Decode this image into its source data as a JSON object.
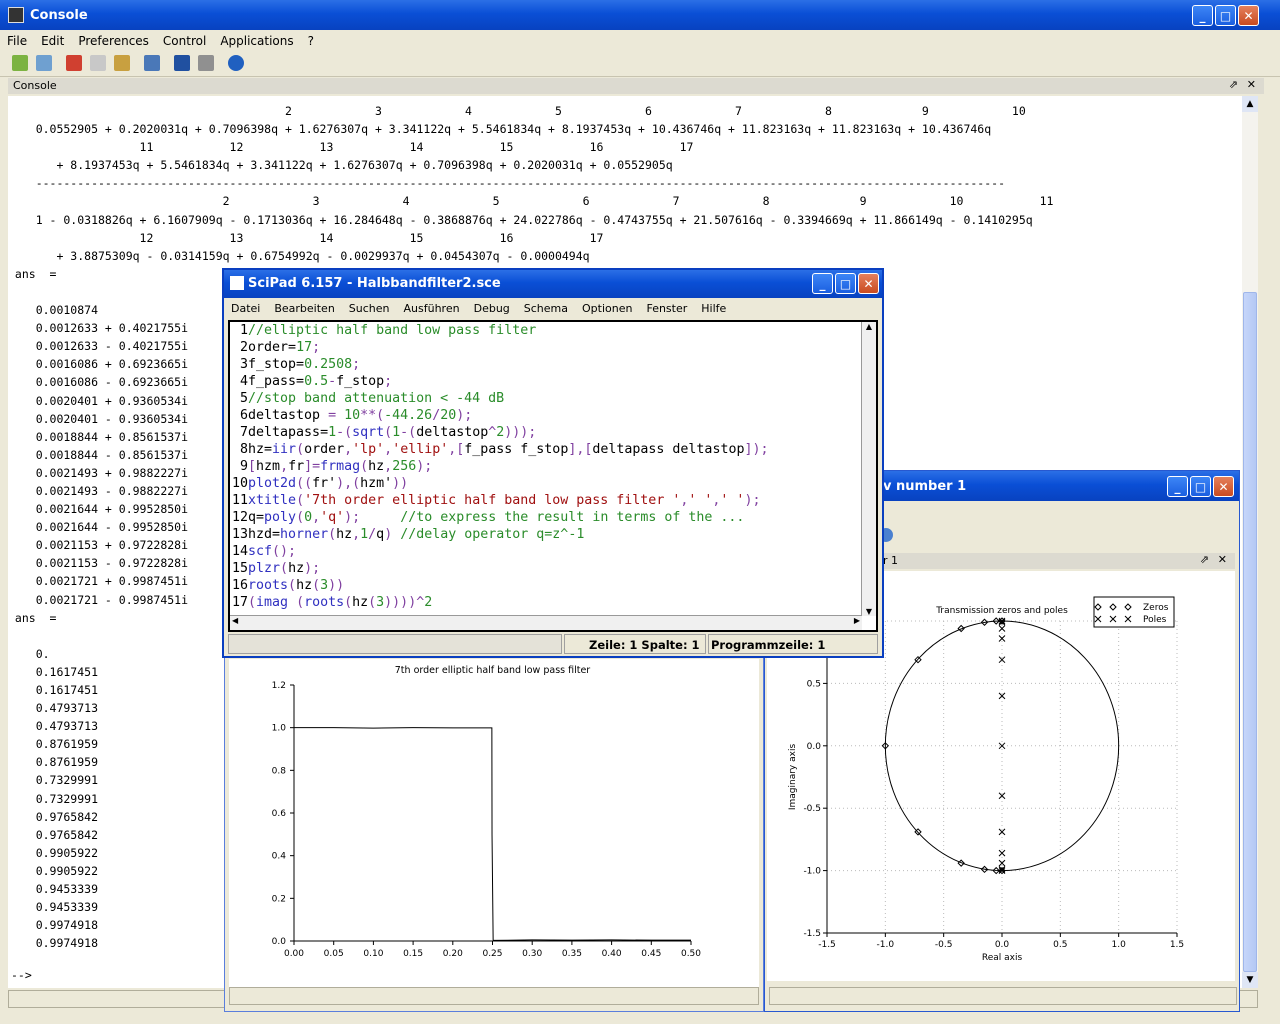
{
  "console": {
    "title": "Console",
    "menu": [
      "File",
      "Edit",
      "Preferences",
      "Control",
      "Applications",
      "?"
    ],
    "panel_label": "Console",
    "toolbar_icons": [
      "new-file-icon",
      "open-file-icon",
      "cut-icon",
      "copy-icon",
      "paste-icon",
      "folder-icon",
      "font-icon",
      "print-icon",
      "help-icon"
    ],
    "lines": [
      "                                        2            3            4            5            6            7            8             9            10",
      "    0.0552905 + 0.2020031q + 0.7096398q + 1.6276307q + 3.341122q + 5.5461834q + 8.1937453q + 10.436746q + 11.823163q + 11.823163q + 10.436746q",
      "                   11           12           13           14           15           16           17",
      "       + 8.1937453q + 5.5461834q + 3.341122q + 1.6276307q + 0.7096398q + 0.2020031q + 0.0552905q",
      "    --------------------------------------------------------------------------------------------------------------------------------------------",
      "                               2            3            4            5            6            7            8             9            10           11",
      "    1 - 0.0318826q + 6.1607909q - 0.1713036q + 16.284648q - 0.3868876q + 24.022786q - 0.4743755q + 21.507616q - 0.3394669q + 11.866149q - 0.1410295q",
      "                   12           13           14           15           16           17",
      "       + 3.8875309q - 0.0314159q + 0.6754992q - 0.0029937q + 0.0454307q - 0.0000494q",
      " ans  =",
      "",
      "    0.0010874",
      "    0.0012633 + 0.4021755i",
      "    0.0012633 - 0.4021755i",
      "    0.0016086 + 0.6923665i",
      "    0.0016086 - 0.6923665i",
      "    0.0020401 + 0.9360534i",
      "    0.0020401 - 0.9360534i",
      "    0.0018844 + 0.8561537i",
      "    0.0018844 - 0.8561537i",
      "    0.0021493 + 0.9882227i",
      "    0.0021493 - 0.9882227i",
      "    0.0021644 + 0.9952850i",
      "    0.0021644 - 0.9952850i",
      "    0.0021153 + 0.9722828i",
      "    0.0021153 - 0.9722828i",
      "    0.0021721 + 0.9987451i",
      "    0.0021721 - 0.9987451i",
      " ans  =",
      "",
      "    0.",
      "    0.1617451",
      "    0.1617451",
      "    0.4793713",
      "    0.4793713",
      "    0.8761959",
      "    0.8761959",
      "    0.7329991",
      "    0.7329991",
      "    0.9765842",
      "    0.9765842",
      "    0.9905922",
      "    0.9905922",
      "    0.9453339",
      "    0.9453339",
      "    0.9974918",
      "    0.9974918"
    ],
    "prompt": "-->"
  },
  "scipad": {
    "title": "SciPad 6.157 - Halbbandfilter2.sce",
    "menu": [
      "Datei",
      "Bearbeiten",
      "Suchen",
      "Ausführen",
      "Debug",
      "Schema",
      "Optionen",
      "Fenster",
      "Hilfe"
    ],
    "status_position": "Zeile: 1 Spalte: 1",
    "status_program_line": "Programmzeile: 1",
    "code": [
      {
        "n": "1",
        "segs": [
          [
            "g",
            "//elliptic half band low pass filter"
          ]
        ]
      },
      {
        "n": "2",
        "segs": [
          [
            "k",
            "order="
          ],
          [
            "g",
            "17"
          ],
          [
            "p",
            ";"
          ]
        ]
      },
      {
        "n": "3",
        "segs": [
          [
            "k",
            "f_stop="
          ],
          [
            "g",
            "0.2508"
          ],
          [
            "p",
            ";"
          ]
        ]
      },
      {
        "n": "4",
        "segs": [
          [
            "k",
            "f_pass="
          ],
          [
            "g",
            "0.5"
          ],
          [
            "p",
            "-"
          ],
          [
            "k",
            "f_stop"
          ],
          [
            "p",
            ";"
          ]
        ]
      },
      {
        "n": "5",
        "segs": [
          [
            "g",
            "//stop band attenuation < -44 dB"
          ]
        ]
      },
      {
        "n": "6",
        "segs": [
          [
            "k",
            "deltastop "
          ],
          [
            "p",
            "= "
          ],
          [
            "g",
            "10"
          ],
          [
            "p",
            "**("
          ],
          [
            "g",
            "-44.26"
          ],
          [
            "p",
            "/"
          ],
          [
            "g",
            "20"
          ],
          [
            "p",
            ");"
          ]
        ]
      },
      {
        "n": "7",
        "segs": [
          [
            "k",
            "deltapass="
          ],
          [
            "g",
            "1"
          ],
          [
            "p",
            "-("
          ],
          [
            "b",
            "sqrt"
          ],
          [
            "p",
            "("
          ],
          [
            "g",
            "1"
          ],
          [
            "p",
            "-("
          ],
          [
            "k",
            "deltastop"
          ],
          [
            "p",
            "^"
          ],
          [
            "g",
            "2"
          ],
          [
            "p",
            ")));"
          ]
        ]
      },
      {
        "n": "8",
        "segs": [
          [
            "k",
            "hz="
          ],
          [
            "b",
            "iir"
          ],
          [
            "p",
            "("
          ],
          [
            "k",
            "order"
          ],
          [
            "p",
            ","
          ],
          [
            "r",
            "'lp'"
          ],
          [
            "p",
            ","
          ],
          [
            "r",
            "'ellip'"
          ],
          [
            "p",
            ",["
          ],
          [
            "k",
            "f_pass f_stop"
          ],
          [
            "p",
            "],["
          ],
          [
            "k",
            "deltapass deltastop"
          ],
          [
            "p",
            "]);"
          ]
        ]
      },
      {
        "n": "9",
        "segs": [
          [
            "p",
            "["
          ],
          [
            "k",
            "hzm"
          ],
          [
            "p",
            ","
          ],
          [
            "k",
            "fr"
          ],
          [
            "p",
            "]="
          ],
          [
            "b",
            "frmag"
          ],
          [
            "p",
            "("
          ],
          [
            "k",
            "hz"
          ],
          [
            "p",
            ","
          ],
          [
            "g",
            "256"
          ],
          [
            "p",
            ");"
          ]
        ]
      },
      {
        "n": "10",
        "segs": [
          [
            "b",
            "plot2d"
          ],
          [
            "p",
            "(("
          ],
          [
            "k",
            "fr'"
          ],
          [
            "p",
            "),("
          ],
          [
            "k",
            "hzm'"
          ],
          [
            "p",
            "))"
          ]
        ]
      },
      {
        "n": "11",
        "segs": [
          [
            "b",
            "xtitle"
          ],
          [
            "p",
            "("
          ],
          [
            "r",
            "'7th order elliptic half band low pass filter '"
          ],
          [
            "p",
            ","
          ],
          [
            "r",
            "' '"
          ],
          [
            "p",
            ","
          ],
          [
            "r",
            "' '"
          ],
          [
            "p",
            ");"
          ]
        ]
      },
      {
        "n": "12",
        "segs": [
          [
            "k",
            "q="
          ],
          [
            "b",
            "poly"
          ],
          [
            "p",
            "("
          ],
          [
            "g",
            "0"
          ],
          [
            "p",
            ","
          ],
          [
            "r",
            "'q'"
          ],
          [
            "p",
            ");     "
          ],
          [
            "g",
            "//to express the result in terms of the ..."
          ]
        ]
      },
      {
        "n": "13",
        "segs": [
          [
            "k",
            "hzd="
          ],
          [
            "b",
            "horner"
          ],
          [
            "p",
            "("
          ],
          [
            "k",
            "hz"
          ],
          [
            "p",
            ","
          ],
          [
            "g",
            "1"
          ],
          [
            "p",
            "/"
          ],
          [
            "k",
            "q"
          ],
          [
            "p",
            ") "
          ],
          [
            "g",
            "//delay operator q=z^-1"
          ]
        ]
      },
      {
        "n": "14",
        "segs": [
          [
            "b",
            "scf"
          ],
          [
            "p",
            "();"
          ]
        ]
      },
      {
        "n": "15",
        "segs": [
          [
            "b",
            "plzr"
          ],
          [
            "p",
            "("
          ],
          [
            "k",
            "hz"
          ],
          [
            "p",
            ");"
          ]
        ]
      },
      {
        "n": "16",
        "segs": [
          [
            "b",
            "roots"
          ],
          [
            "p",
            "("
          ],
          [
            "k",
            "hz"
          ],
          [
            "p",
            "("
          ],
          [
            "g",
            "3"
          ],
          [
            "p",
            "))"
          ]
        ]
      },
      {
        "n": "17",
        "segs": [
          [
            "p",
            "("
          ],
          [
            "b",
            "imag"
          ],
          [
            "p",
            " ("
          ],
          [
            "b",
            "roots"
          ],
          [
            "p",
            "("
          ],
          [
            "k",
            "hz"
          ],
          [
            "p",
            "("
          ],
          [
            "g",
            "3"
          ],
          [
            "p",
            "))))^"
          ],
          [
            "g",
            "2"
          ]
        ]
      }
    ]
  },
  "graphic1": {
    "chart_data": {
      "type": "line",
      "title": "7th order elliptic half band low pass filter",
      "xlabel": "",
      "ylabel": "",
      "xlim": [
        0,
        0.5
      ],
      "ylim": [
        0,
        1.2
      ],
      "xticks": [
        "0.00",
        "0.05",
        "0.10",
        "0.15",
        "0.20",
        "0.25",
        "0.30",
        "0.35",
        "0.40",
        "0.45",
        "0.50"
      ],
      "yticks": [
        "0.0",
        "0.2",
        "0.4",
        "0.6",
        "0.8",
        "1.0",
        "1.2"
      ],
      "series": [
        {
          "x": [
            0.0,
            0.05,
            0.1,
            0.15,
            0.2,
            0.2492,
            0.2494,
            0.2508,
            0.251,
            0.3,
            0.35,
            0.4,
            0.45,
            0.5
          ],
          "y": [
            1.0,
            1.0,
            0.998,
            1.0,
            0.999,
            0.999,
            0.5,
            0.006,
            0.003,
            0.005,
            0.004,
            0.005,
            0.004,
            0.004
          ]
        }
      ]
    }
  },
  "graphic2": {
    "title_visible": "v number 1",
    "panel_label": "r 1",
    "chart_data": {
      "type": "scatter",
      "title": "Transmission zeros and poles",
      "xlabel": "Real axis",
      "ylabel": "Imaginary axis",
      "xlim": [
        -1.5,
        1.5
      ],
      "ylim": [
        -1.5,
        1.0
      ],
      "xticks": [
        "-1.5",
        "-1.0",
        "-0.5",
        "0.0",
        "0.5",
        "1.0",
        "1.5"
      ],
      "yticks": [
        "1.0",
        "0.5",
        "0.0",
        "-0.5",
        "-1.0",
        "-1.5"
      ],
      "legend": {
        "zeros": "Zeros",
        "poles": "Poles",
        "position": "top-right"
      },
      "zeros": [
        [
          -1.0,
          0.0
        ],
        [
          -0.72,
          0.69
        ],
        [
          -0.72,
          -0.69
        ],
        [
          -0.35,
          0.94
        ],
        [
          -0.35,
          -0.94
        ],
        [
          -0.15,
          0.99
        ],
        [
          -0.15,
          -0.99
        ],
        [
          -0.05,
          1.0
        ],
        [
          -0.05,
          -1.0
        ],
        [
          0.0,
          1.0
        ],
        [
          0.0,
          -1.0
        ]
      ],
      "poles": [
        [
          0.0,
          0.0
        ],
        [
          0.0,
          0.4
        ],
        [
          0.0,
          -0.4
        ],
        [
          0.0,
          0.69
        ],
        [
          0.0,
          -0.69
        ],
        [
          0.0,
          0.86
        ],
        [
          0.0,
          -0.86
        ],
        [
          0.0,
          0.94
        ],
        [
          0.0,
          -0.94
        ],
        [
          0.0,
          0.99
        ],
        [
          0.0,
          -0.99
        ],
        [
          0.0,
          1.0
        ],
        [
          0.0,
          -1.0
        ]
      ]
    }
  }
}
